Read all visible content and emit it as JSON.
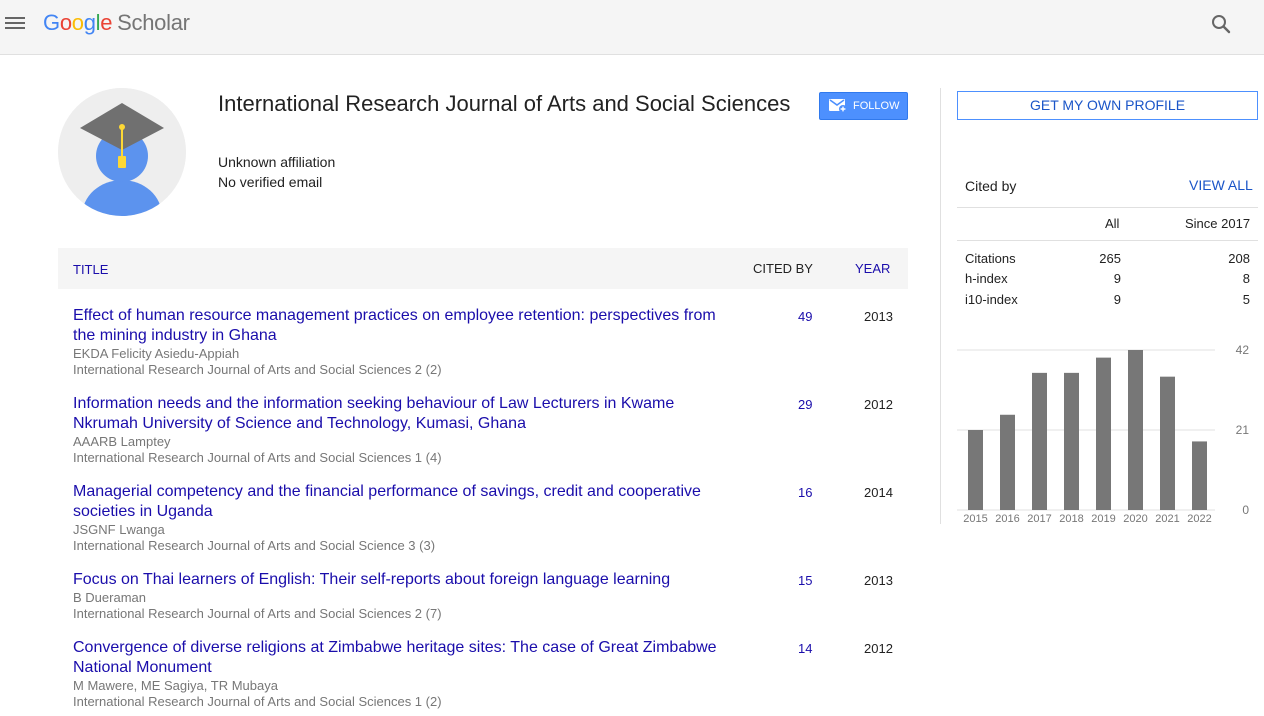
{
  "header": {
    "logo_letters": [
      "G",
      "o",
      "o",
      "g",
      "l",
      "e"
    ],
    "logo_product": "Scholar",
    "menu_icon": "hamburger-menu-icon",
    "search_icon": "search-icon"
  },
  "profile": {
    "name": "International Research Journal of Arts and Social Sciences",
    "affiliation": "Unknown affiliation",
    "email": "No verified email",
    "follow_label": "FOLLOW"
  },
  "table": {
    "headers": {
      "title": "TITLE",
      "cited_by": "CITED BY",
      "year": "YEAR"
    },
    "rows": [
      {
        "title": "Effect of human resource management practices on employee retention: perspectives from the mining industry in Ghana",
        "authors": "EKDA Felicity Asiedu-Appiah",
        "venue": "International Research Journal of Arts and Social Sciences 2 (2)",
        "cited_by": "49",
        "year": "2013"
      },
      {
        "title": "Information needs and the information seeking behaviour of Law Lecturers in Kwame Nkrumah University of Science and Technology, Kumasi, Ghana",
        "authors": "AAARB Lamptey",
        "venue": "International Research Journal of Arts and Social Sciences 1 (4)",
        "cited_by": "29",
        "year": "2012"
      },
      {
        "title": "Managerial competency and the financial performance of savings, credit and cooperative societies in Uganda",
        "authors": "JSGNF Lwanga",
        "venue": "International Research Journal of Arts and Social Science 3 (3)",
        "cited_by": "16",
        "year": "2014"
      },
      {
        "title": "Focus on Thai learners of English: Their self-reports about foreign language learning",
        "authors": "B Dueraman",
        "venue": "International Research Journal of Arts and Social Sciences 2 (7)",
        "cited_by": "15",
        "year": "2013"
      },
      {
        "title": "Convergence of diverse religions at Zimbabwe heritage sites: The case of Great Zimbabwe National Monument",
        "authors": "M Mawere, ME Sagiya, TR Mubaya",
        "venue": "International Research Journal of Arts and Social Sciences 1 (2)",
        "cited_by": "14",
        "year": "2012"
      }
    ]
  },
  "sidebar": {
    "get_profile_label": "GET MY OWN PROFILE",
    "cited_by_label": "Cited by",
    "view_all_label": "VIEW ALL",
    "col_all": "All",
    "col_since": "Since 2017",
    "stats": [
      {
        "label": "Citations",
        "all": "265",
        "since": "208"
      },
      {
        "label": "h-index",
        "all": "9",
        "since": "8"
      },
      {
        "label": "i10-index",
        "all": "9",
        "since": "5"
      }
    ]
  },
  "chart_data": {
    "type": "bar",
    "categories": [
      "2015",
      "2016",
      "2017",
      "2018",
      "2019",
      "2020",
      "2021",
      "2022"
    ],
    "values": [
      21,
      25,
      36,
      36,
      40,
      42,
      35,
      18
    ],
    "ylim": [
      0,
      42
    ],
    "yticks": [
      "42",
      "21",
      "0"
    ],
    "bar_color": "#777777",
    "grid": true
  },
  "colors": {
    "link": "#1a0dab",
    "accent": "#4d90fe",
    "topbar": "#f5f5f5"
  }
}
